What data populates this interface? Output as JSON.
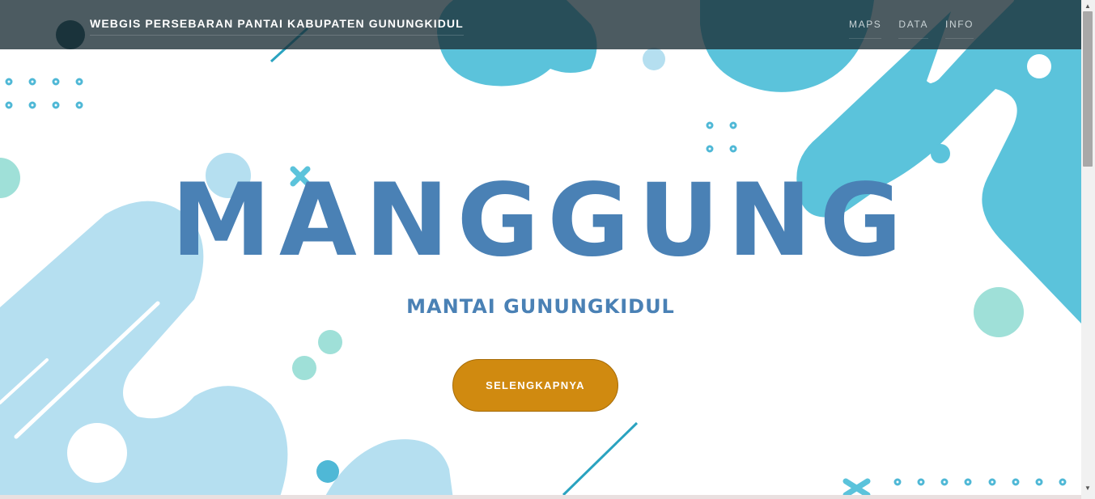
{
  "navbar": {
    "brand": "WEBGIS PERSEBARAN PANTAI KABUPATEN GUNUNGKIDUL",
    "links": [
      "MAPS",
      "DATA",
      "INFO"
    ]
  },
  "hero": {
    "title": "MANGGUNG",
    "subtitle": "MANTAI GUNUNGKIDUL",
    "button_label": "SELENGKAPNYA"
  },
  "colors": {
    "title": "#4a81b5",
    "button": "#d08a10",
    "navbar": "#192d34",
    "shape_blue": "#5bc3db",
    "shape_light": "#b5dff0",
    "shape_mint": "#9fe0d8"
  }
}
